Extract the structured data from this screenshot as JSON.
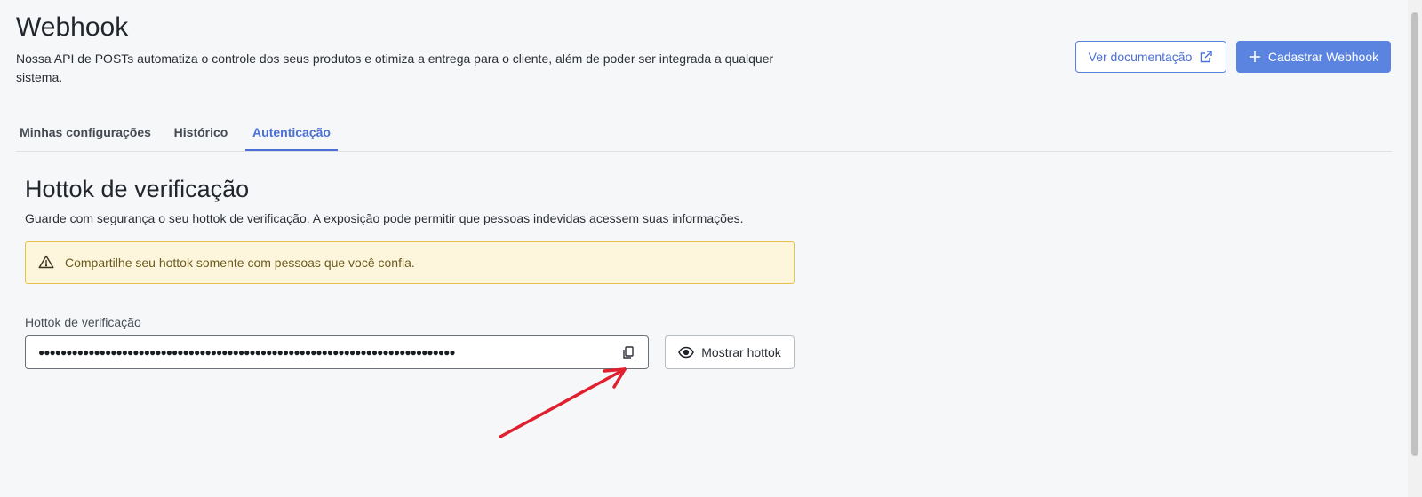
{
  "header": {
    "title": "Webhook",
    "description": "Nossa API de POSTs automatiza o controle dos seus produtos e otimiza a entrega para o cliente, além de poder ser integrada a qualquer sistema.",
    "doc_button_label": "Ver documentação",
    "register_button_label": "Cadastrar Webhook"
  },
  "tabs": [
    {
      "label": "Minhas configurações",
      "active": false
    },
    {
      "label": "Histórico",
      "active": false
    },
    {
      "label": "Autenticação",
      "active": true
    }
  ],
  "section": {
    "title": "Hottok de verificação",
    "description": "Guarde com segurança o seu hottok de verificação. A exposição pode permitir que pessoas indevidas acessem suas informações."
  },
  "alert": {
    "text": "Compartilhe seu hottok somente com pessoas que você confia.",
    "icon": "warning-icon"
  },
  "field": {
    "label": "Hottok de verificação",
    "masked_value": "●●●●●●●●●●●●●●●●●●●●●●●●●●●●●●●●●●●●●●●●●●●●●●●●●●●●●●●●●●●●●●●●●●●●●●●●●●●",
    "copy_icon": "copy-icon"
  },
  "show_button_label": "Mostrar hottok",
  "colors": {
    "primary": "#5b83e0",
    "active_tab": "#4a6fd6",
    "alert_bg": "#fdf6dc",
    "alert_border": "#e6c24a",
    "annotation_arrow": "#e0202f"
  }
}
